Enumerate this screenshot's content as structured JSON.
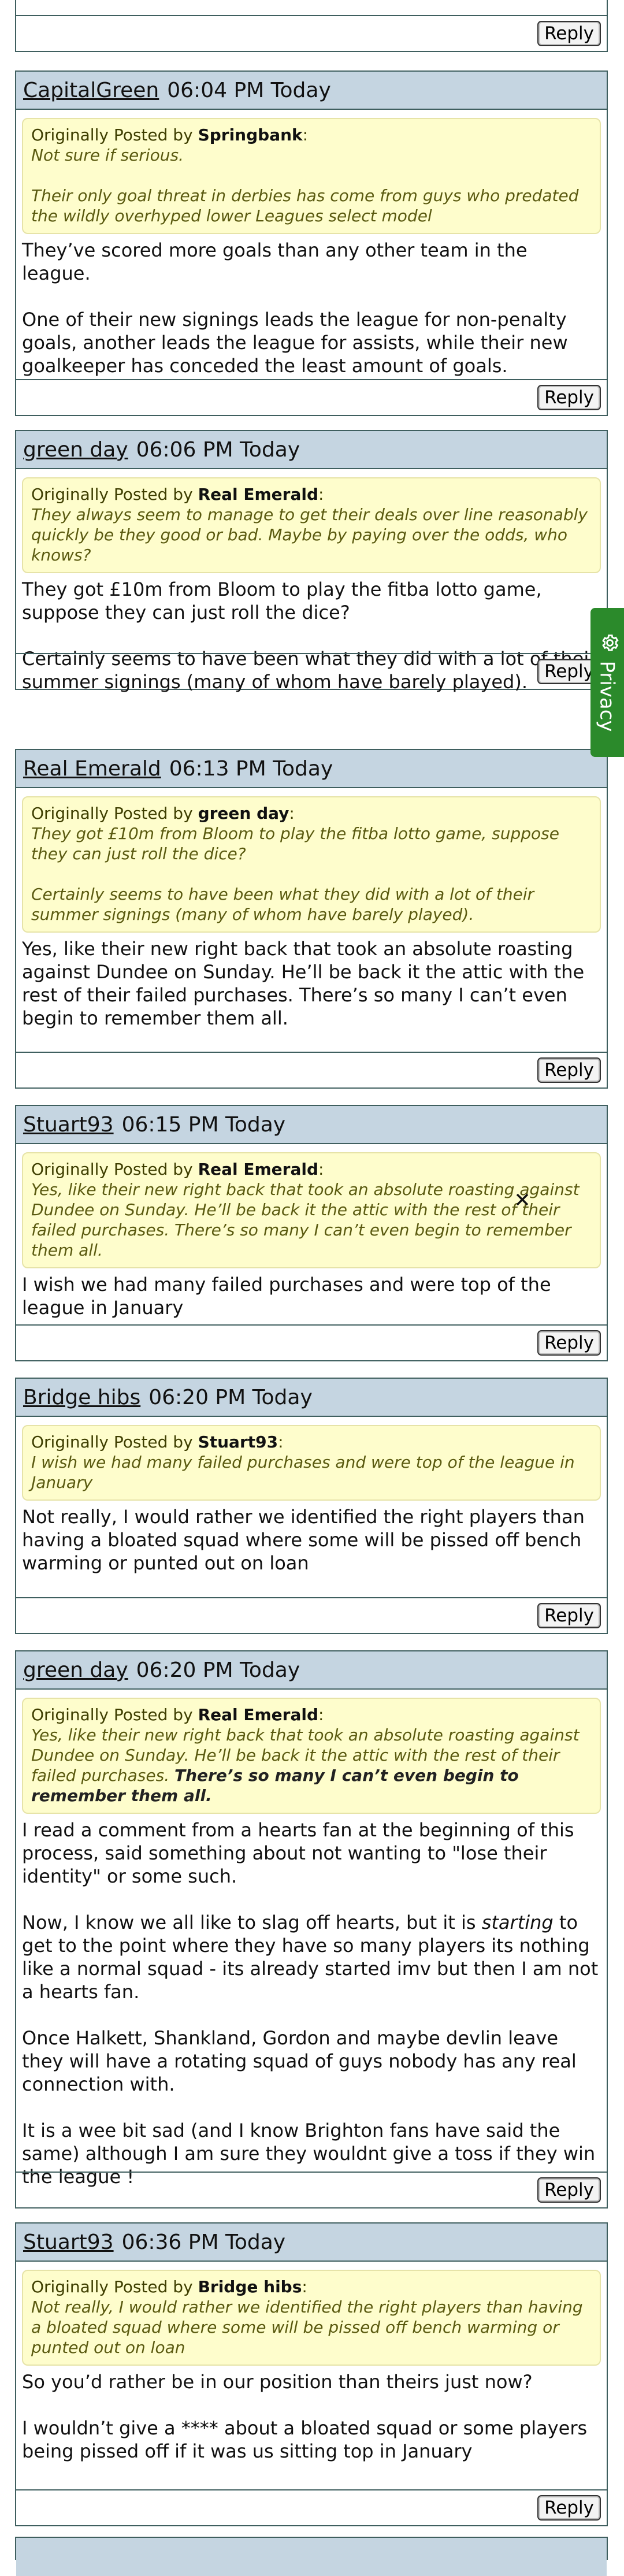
{
  "reply_label": "Reply",
  "privacy_label": "Privacy",
  "posts": [
    {
      "user": "CapitalGreen",
      "time": "06:04 PM Today",
      "quote_prefix": "Originally Posted by",
      "quote_author": "Springbank",
      "quote_lines": [
        "Not sure if serious.",
        "Their only goal threat in derbies has come from guys who predated the wildly overhyped lower Leagues select model"
      ],
      "paras": [
        "They’ve scored more goals than any other team in the league.",
        "One of their new signings leads the league for non-penalty goals, another leads the league for assists, while their new goalkeeper has conceded the least amount of goals."
      ]
    },
    {
      "user": "green day",
      "time": "06:06 PM Today",
      "quote_prefix": "Originally Posted by",
      "quote_author": "Real Emerald",
      "quote_lines": [
        "They always seem to manage to get their deals over line reasonably quickly be they good or bad. Maybe by paying over the odds, who knows?"
      ],
      "paras": [
        "They got £10m from Bloom to play the fitba lotto game, suppose they can just roll the dice?",
        "Certainly seems to have been what they did with a lot of their summer signings (many of whom have barely played)."
      ]
    },
    {
      "user": "Real Emerald",
      "time": "06:13 PM Today",
      "quote_prefix": "Originally Posted by",
      "quote_author": "green day",
      "quote_lines": [
        "They got £10m from Bloom to play the fitba lotto game, suppose they can just roll the dice?",
        "Certainly seems to have been what they did with a lot of their summer signings (many of whom have barely played)."
      ],
      "paras": [
        "Yes, like their new right back that took an absolute roasting against Dundee on Sunday. He’ll be back it the attic with the rest of their failed purchases. There’s so many I can’t even begin to remember them all."
      ]
    },
    {
      "user": "Stuart93",
      "time": "06:15 PM Today",
      "quote_prefix": "Originally Posted by",
      "quote_author": "Real Emerald",
      "quote_lines": [
        "Yes, like their new right back that took an absolute roasting against Dundee on Sunday. He’ll be back it the attic with the rest of their failed purchases. There’s so many I can’t even begin to remember them all."
      ],
      "paras": [
        "I wish we had many failed purchases and were top of the league in January"
      ]
    },
    {
      "user": "Bridge hibs",
      "time": "06:20 PM Today",
      "quote_prefix": "Originally Posted by",
      "quote_author": "Stuart93",
      "quote_lines": [
        "I wish we had many failed purchases and were top of the league in January"
      ],
      "paras": [
        "Not really, I would rather we identified the right players than having a bloated squad where some will be pissed off bench warming or punted out on loan"
      ]
    },
    {
      "user": "green day",
      "time": "06:20 PM Today",
      "quote_prefix": "Originally Posted by",
      "quote_author": "Real Emerald",
      "quote_lines": [
        "Yes, like their new right back that took an absolute roasting against Dundee on Sunday. He’ll be back it the attic with the rest of their failed purchases."
      ],
      "quote_bold": "There’s so many I can’t even begin to remember them all.",
      "paras": [
        "I read a comment from a hearts fan at the beginning of this process, said something about not wanting to \"lose their identity\" or some such."
      ],
      "para2_a": "Now, I know we all like to slag off hearts, but it is ",
      "para2_i": "starting",
      "para2_b": " to get to the point where they have so many players its nothing like a normal squad - its already started imv but then I am not a hearts fan.",
      "paras_after": [
        "Once Halkett, Shankland, Gordon and maybe devlin leave they will have a rotating squad of guys nobody has any real connection with.",
        "It is a wee bit sad (and I know Brighton fans have said the same) although I am sure they wouldnt give a toss if they win the league !"
      ]
    },
    {
      "user": "Stuart93",
      "time": "06:36 PM Today",
      "quote_prefix": "Originally Posted by",
      "quote_author": "Bridge hibs",
      "quote_lines": [
        "Not really, I would rather we identified the right players than having a bloated squad where some will be pissed off bench warming or punted out on loan"
      ],
      "paras": [
        "So you’d rather be in our position than theirs just now?",
        "I wouldn’t give a **** about a bloated squad or some players being pissed off if it was us sitting top in January"
      ]
    }
  ]
}
